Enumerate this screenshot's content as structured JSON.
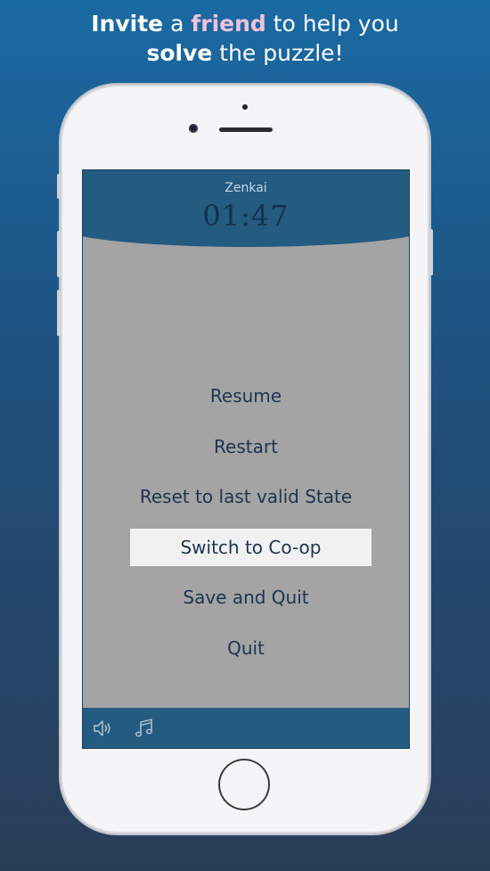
{
  "headline": {
    "line1_part1": "Invite",
    "line1_part2": " a ",
    "line1_part3": "friend",
    "line1_part4": " to help you",
    "line2_part1": "solve",
    "line2_part2": " the puzzle!"
  },
  "colors": {
    "accent_pink": "#f0c2d8",
    "bar_blue": "#235b81",
    "menu_text": "#1d3450",
    "screen_gray": "#a4a4a4"
  },
  "app": {
    "title": "Zenkai",
    "timer": "01:47"
  },
  "menu": {
    "items": [
      {
        "label": "Resume"
      },
      {
        "label": "Restart"
      },
      {
        "label": "Reset to last valid State"
      },
      {
        "label": "Switch to Co-op",
        "selected": true
      },
      {
        "label": "Save and Quit"
      },
      {
        "label": "Quit"
      }
    ]
  },
  "bottom_bar": {
    "icons": [
      "speaker-icon",
      "music-note-icon"
    ]
  }
}
